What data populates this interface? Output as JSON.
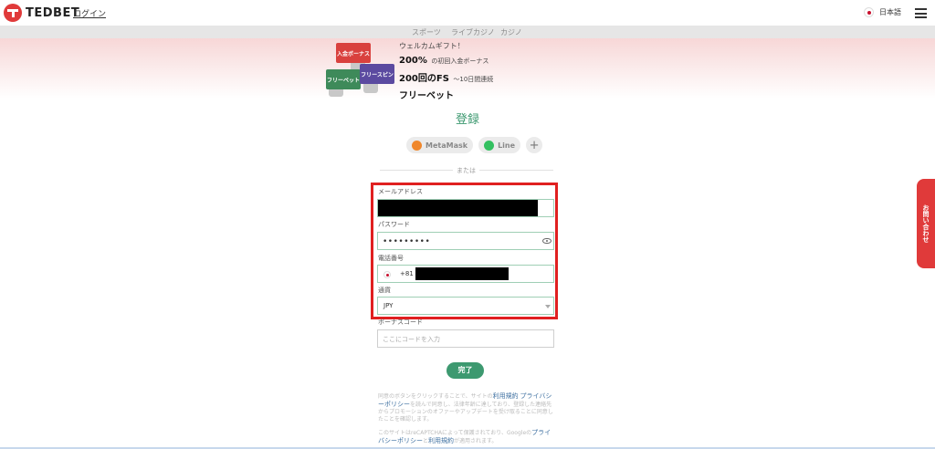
{
  "header": {
    "brand": "TEDBET",
    "login": "ログイン",
    "language": "日本語"
  },
  "tabs": [
    {
      "label": "スポーツ",
      "active": false
    },
    {
      "label": "ライブカジノ",
      "active": false
    },
    {
      "label": "カジノ",
      "active": true
    }
  ],
  "promo": {
    "badges": [
      "入金ボーナス",
      "フリーベット",
      "フリースピン"
    ],
    "welcome": "ウェルカムギフト！",
    "line2_bold": "200%",
    "line2_rest": "の初回入金ボーナス",
    "line3_bold": "200回のFS",
    "line3_rest": "～10日間連続",
    "line4": "フリーベット"
  },
  "register": {
    "title": "登録",
    "social": [
      "MetaMask",
      "Line"
    ],
    "more": "+",
    "divider": "または"
  },
  "form": {
    "email_label": "メールアドレス",
    "password_label": "パスワード",
    "password_value": "•••••••••",
    "phone_label": "電話番号",
    "phone_code": "+81",
    "currency_label": "通貨",
    "currency_value": "JPY",
    "bonus_label": "ボーナスコード",
    "bonus_placeholder": "ここにコードを入力",
    "submit": "完了"
  },
  "terms": {
    "p1_pre": "同意のボタンをクリックすることで、サイトの",
    "p1_link1": "利用規約",
    "p1_link2": "プライバシーポリシー",
    "p1_post": "を読んで同意し、法律年齢に達しており、登録した連絡先からプロモーションのオファーやアップデートを受け取ることに同意したことを確認します。",
    "p2_pre": "このサイトはreCAPTCHAによって保護されており、Googleの",
    "p2_link1": "プライバシーポリシー",
    "p2_mid": "と",
    "p2_link2": "利用規約",
    "p2_post": "が適用されます。"
  },
  "contact_tab": "お問い合わせ",
  "colors": {
    "accent": "#3d9970",
    "brand_red": "#e03a3a",
    "highlight": "#e02020"
  }
}
